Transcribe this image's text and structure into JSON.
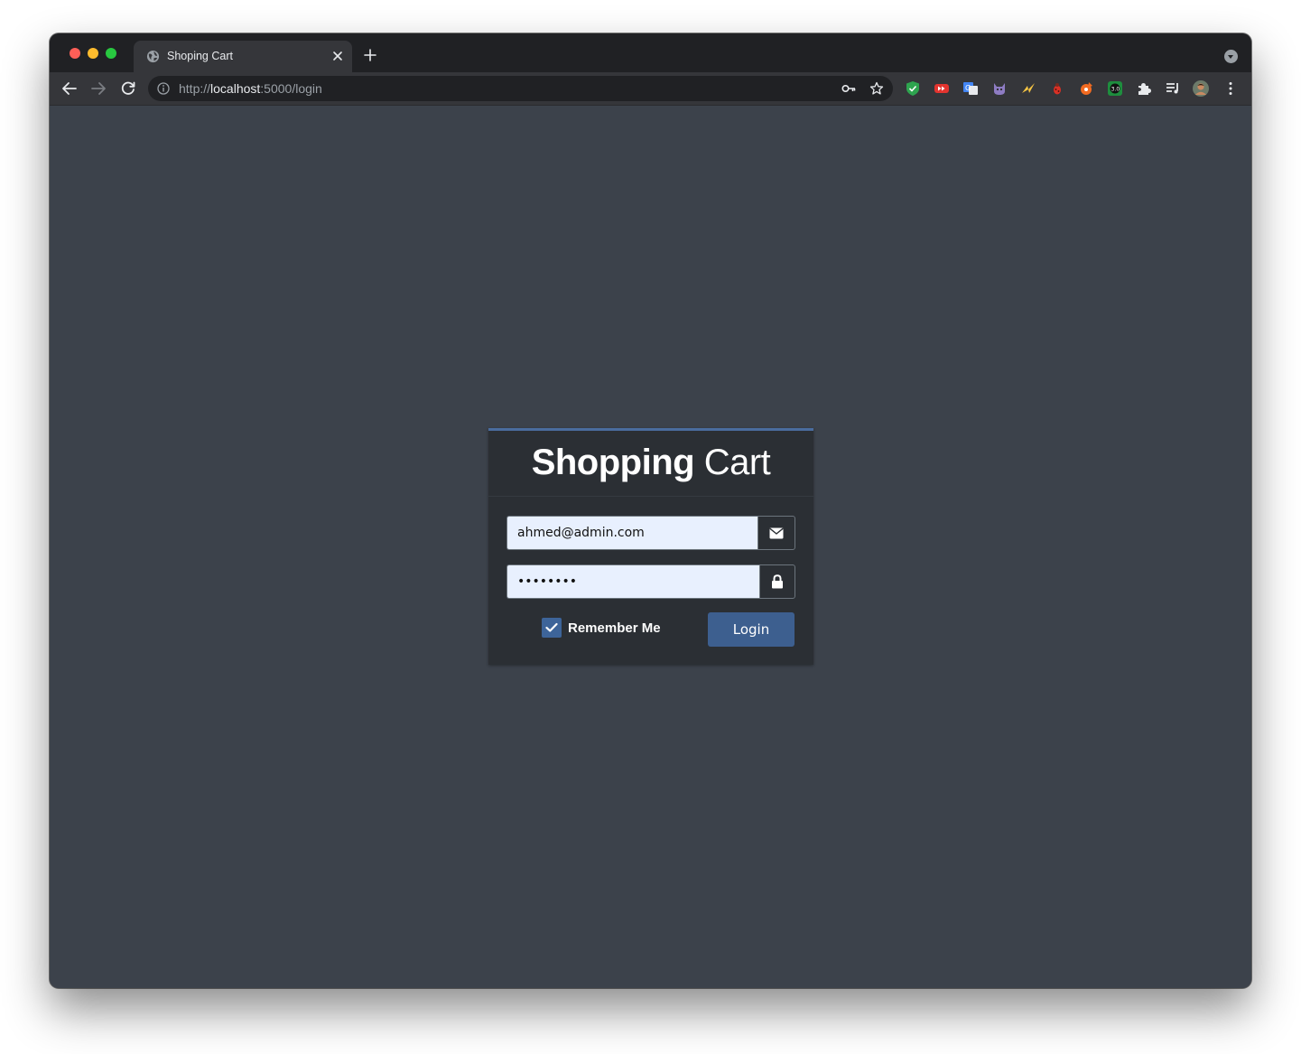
{
  "browser": {
    "tab_title": "Shoping Cart",
    "url_scheme": "http://",
    "url_host": "localhost",
    "url_rest": ":5000/login"
  },
  "extensions": [
    "adblock-shield-icon",
    "youtube-icon",
    "translate-icon",
    "cat-icon",
    "lightning-icon",
    "ladybug-icon",
    "rocket-icon",
    "speed-badge-icon",
    "puzzle-icon",
    "playlist-icon",
    "profile-avatar"
  ],
  "login": {
    "brand_bold": "Shopping",
    "brand_light": "Cart",
    "email_value": "ahmed@admin.com",
    "password_value": "password",
    "remember_label": "Remember Me",
    "remember_checked": true,
    "login_button": "Login"
  },
  "colors": {
    "page_bg": "#3c424b",
    "card_bg": "#2b2f34",
    "accent": "#3d5f8f"
  }
}
